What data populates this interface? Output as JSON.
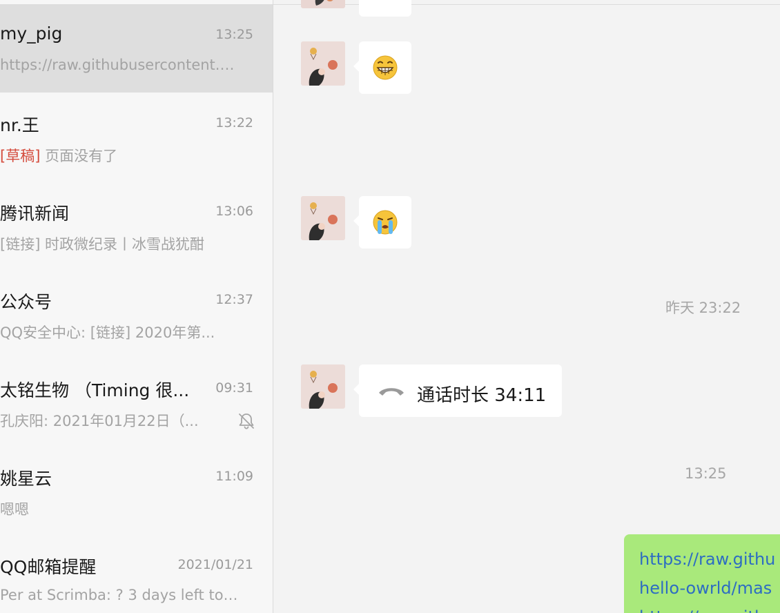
{
  "conversations": [
    {
      "name": "my_pig",
      "time": "13:25",
      "preview": "https://raw.githubusercontent.co...",
      "selected": true
    },
    {
      "name": "nr.王",
      "time": "13:22",
      "draft_tag": "[草稿]",
      "preview": "页面没有了"
    },
    {
      "name": "腾讯新闻",
      "time": "13:06",
      "preview": "[链接] 时政微纪录丨冰雪战犹酣"
    },
    {
      "name": "公众号",
      "time": "12:37",
      "preview": "QQ安全中心: [链接] 2020年第..."
    },
    {
      "name": "太铭生物 （Timing 很...",
      "time": "09:31",
      "preview": "孔庆阳: 2021年01月22日（...",
      "muted": true
    },
    {
      "name": "姚星云",
      "time": "11:09",
      "preview": "嗯嗯"
    },
    {
      "name": "QQ邮箱提醒",
      "time": "2021/01/21",
      "preview": "Per at Scrimba: ? 3 days left to g..."
    }
  ],
  "chat": {
    "timestamps": [
      "昨天 23:22",
      "13:25"
    ],
    "call": {
      "text": "通话时长 34:11",
      "icon": "phone-hangup-icon"
    },
    "emojis": [
      "grinning-emoji",
      "crying-emoji"
    ],
    "my_message_lines": [
      "https://raw.githu",
      "hello-owrld/mas",
      "https://raw.githu"
    ]
  },
  "colors": {
    "list_bg": "#f7f7f7",
    "selected_bg": "#dedede",
    "chat_bg": "#f3f3f3",
    "draft_red": "#d44b3c",
    "my_bubble_green": "#a9e97b",
    "link_blue": "#2d6dc2"
  }
}
